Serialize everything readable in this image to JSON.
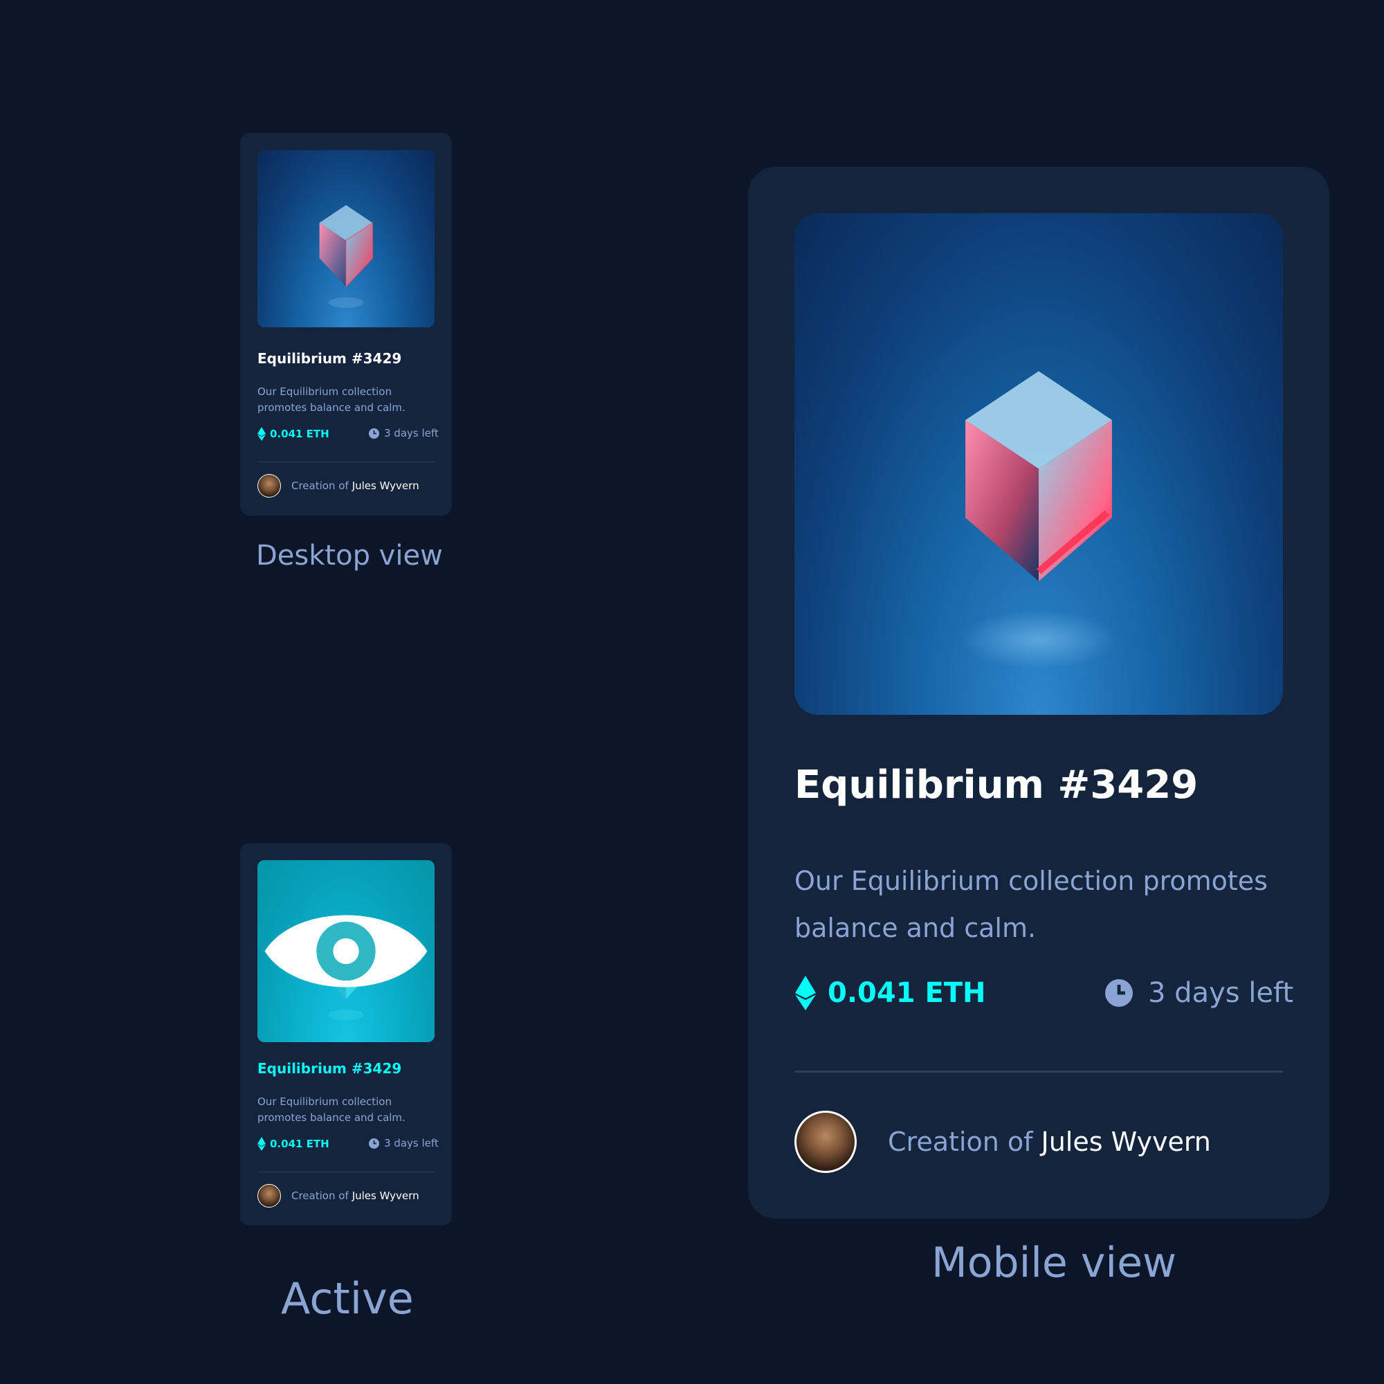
{
  "desktop": {
    "title": "Equilibrium #3429",
    "description": "Our Equilibrium collection promotes balance and calm.",
    "price": "0.041 ETH",
    "time_left": "3 days left",
    "creator_prefix": "Creation of",
    "creator_name": "Jules Wyvern",
    "caption": "Desktop view"
  },
  "active": {
    "title": "Equilibrium #3429",
    "description": "Our Equilibrium collection promotes balance and calm.",
    "price": "0.041 ETH",
    "time_left": "3 days left",
    "creator_prefix": "Creation of",
    "creator_name": "Jules Wyvern",
    "caption": "Active"
  },
  "mobile": {
    "title": "Equilibrium #3429",
    "description": "Our Equilibrium collection promotes balance and calm.",
    "price": "0.041 ETH",
    "time_left": "3 days left",
    "creator_prefix": "Creation of",
    "creator_name": "Jules Wyvern",
    "caption": "Mobile view"
  },
  "icons": {
    "eth": "ethereum-icon",
    "clock": "clock-icon",
    "view": "eye-icon"
  },
  "colors": {
    "background": "#0d1628",
    "card": "#15243d",
    "accent_cyan": "#00fff7",
    "soft_blue": "#8aa4d4",
    "white": "#ffffff"
  }
}
